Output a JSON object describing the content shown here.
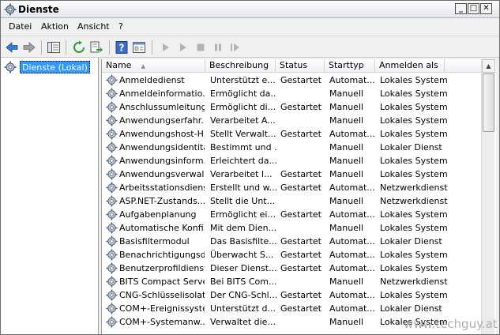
{
  "window": {
    "title": "Dienste",
    "controls": {
      "minimize": "_",
      "maximize": "□",
      "close": "✕"
    }
  },
  "menu": [
    "Datei",
    "Aktion",
    "Ansicht",
    "?"
  ],
  "toolbar": {
    "icons": [
      "back-icon",
      "forward-icon",
      "console-tree-icon",
      "refresh-icon",
      "export-icon",
      "help-icon",
      "properties-icon",
      "start-icon",
      "start-service-icon",
      "stop-icon",
      "pause-icon",
      "restart-icon"
    ]
  },
  "tree": {
    "selected_label": "Dienste (Lokal)"
  },
  "list": {
    "columns": [
      "Name",
      "Beschreibung",
      "Status",
      "Starttyp",
      "Anmelden als"
    ],
    "rows": [
      {
        "name": "Anmeldedienst",
        "desc": "Unterstützt e...",
        "status": "Gestartet",
        "type": "Automat...",
        "logon": "Lokales System"
      },
      {
        "name": "Anmeldeinformatio...",
        "desc": "Ermöglicht da...",
        "status": "",
        "type": "Manuell",
        "logon": "Lokales System"
      },
      {
        "name": "Anschlussumleitung...",
        "desc": "Ermöglicht di...",
        "status": "Gestartet",
        "type": "Manuell",
        "logon": "Lokales System"
      },
      {
        "name": "Anwendungserfahr...",
        "desc": "Verarbeitet A...",
        "status": "",
        "type": "Manuell",
        "logon": "Lokales System"
      },
      {
        "name": "Anwendungshost-H...",
        "desc": "Stellt Verwalt...",
        "status": "Gestartet",
        "type": "Automat...",
        "logon": "Lokales System"
      },
      {
        "name": "Anwendungsidentität",
        "desc": "Bestimmt und ...",
        "status": "",
        "type": "Manuell",
        "logon": "Lokaler Dienst"
      },
      {
        "name": "Anwendungsinform...",
        "desc": "Erleichtert da...",
        "status": "",
        "type": "Manuell",
        "logon": "Lokales System"
      },
      {
        "name": "Anwendungsverwal...",
        "desc": "Verarbeitet I...",
        "status": "Gestartet",
        "type": "Manuell",
        "logon": "Lokales System"
      },
      {
        "name": "Arbeitsstationsdienst",
        "desc": "Erstellt und w...",
        "status": "Gestartet",
        "type": "Automat...",
        "logon": "Netzwerkdienst"
      },
      {
        "name": "ASP.NET-Zustands...",
        "desc": "Stellt die Unt...",
        "status": "",
        "type": "Manuell",
        "logon": "Netzwerkdienst"
      },
      {
        "name": "Aufgabenplanung",
        "desc": "Ermöglicht ei...",
        "status": "Gestartet",
        "type": "Automat...",
        "logon": "Lokales System"
      },
      {
        "name": "Automatische Konfi...",
        "desc": "Mit dem Dien...",
        "status": "",
        "type": "Manuell",
        "logon": "Lokales System"
      },
      {
        "name": "Basisfiltermodul",
        "desc": "Das Basisfilte...",
        "status": "Gestartet",
        "type": "Automat...",
        "logon": "Lokaler Dienst"
      },
      {
        "name": "Benachrichtigungsd...",
        "desc": "Überwacht S...",
        "status": "Gestartet",
        "type": "Automat...",
        "logon": "Lokales System"
      },
      {
        "name": "Benutzerprofildienst",
        "desc": "Dieser Dienst...",
        "status": "Gestartet",
        "type": "Automat...",
        "logon": "Lokales System"
      },
      {
        "name": "BITS Compact Server",
        "desc": "Bei BITS Com...",
        "status": "",
        "type": "Manuell",
        "logon": "Netzwerkdienst"
      },
      {
        "name": "CNG-Schlüsselisolat...",
        "desc": "Der CNG-Schl...",
        "status": "Gestartet",
        "type": "Automat...",
        "logon": "Lokales System"
      },
      {
        "name": "COM+-Ereignissystem",
        "desc": "Unterstützt d...",
        "status": "Gestartet",
        "type": "Automat...",
        "logon": "Lokaler Dienst"
      },
      {
        "name": "COM+-Systemanw...",
        "desc": "Verwaltet die...",
        "status": "",
        "type": "Manuell",
        "logon": "Lokales System"
      }
    ]
  },
  "watermark": "www.techguy.at"
}
